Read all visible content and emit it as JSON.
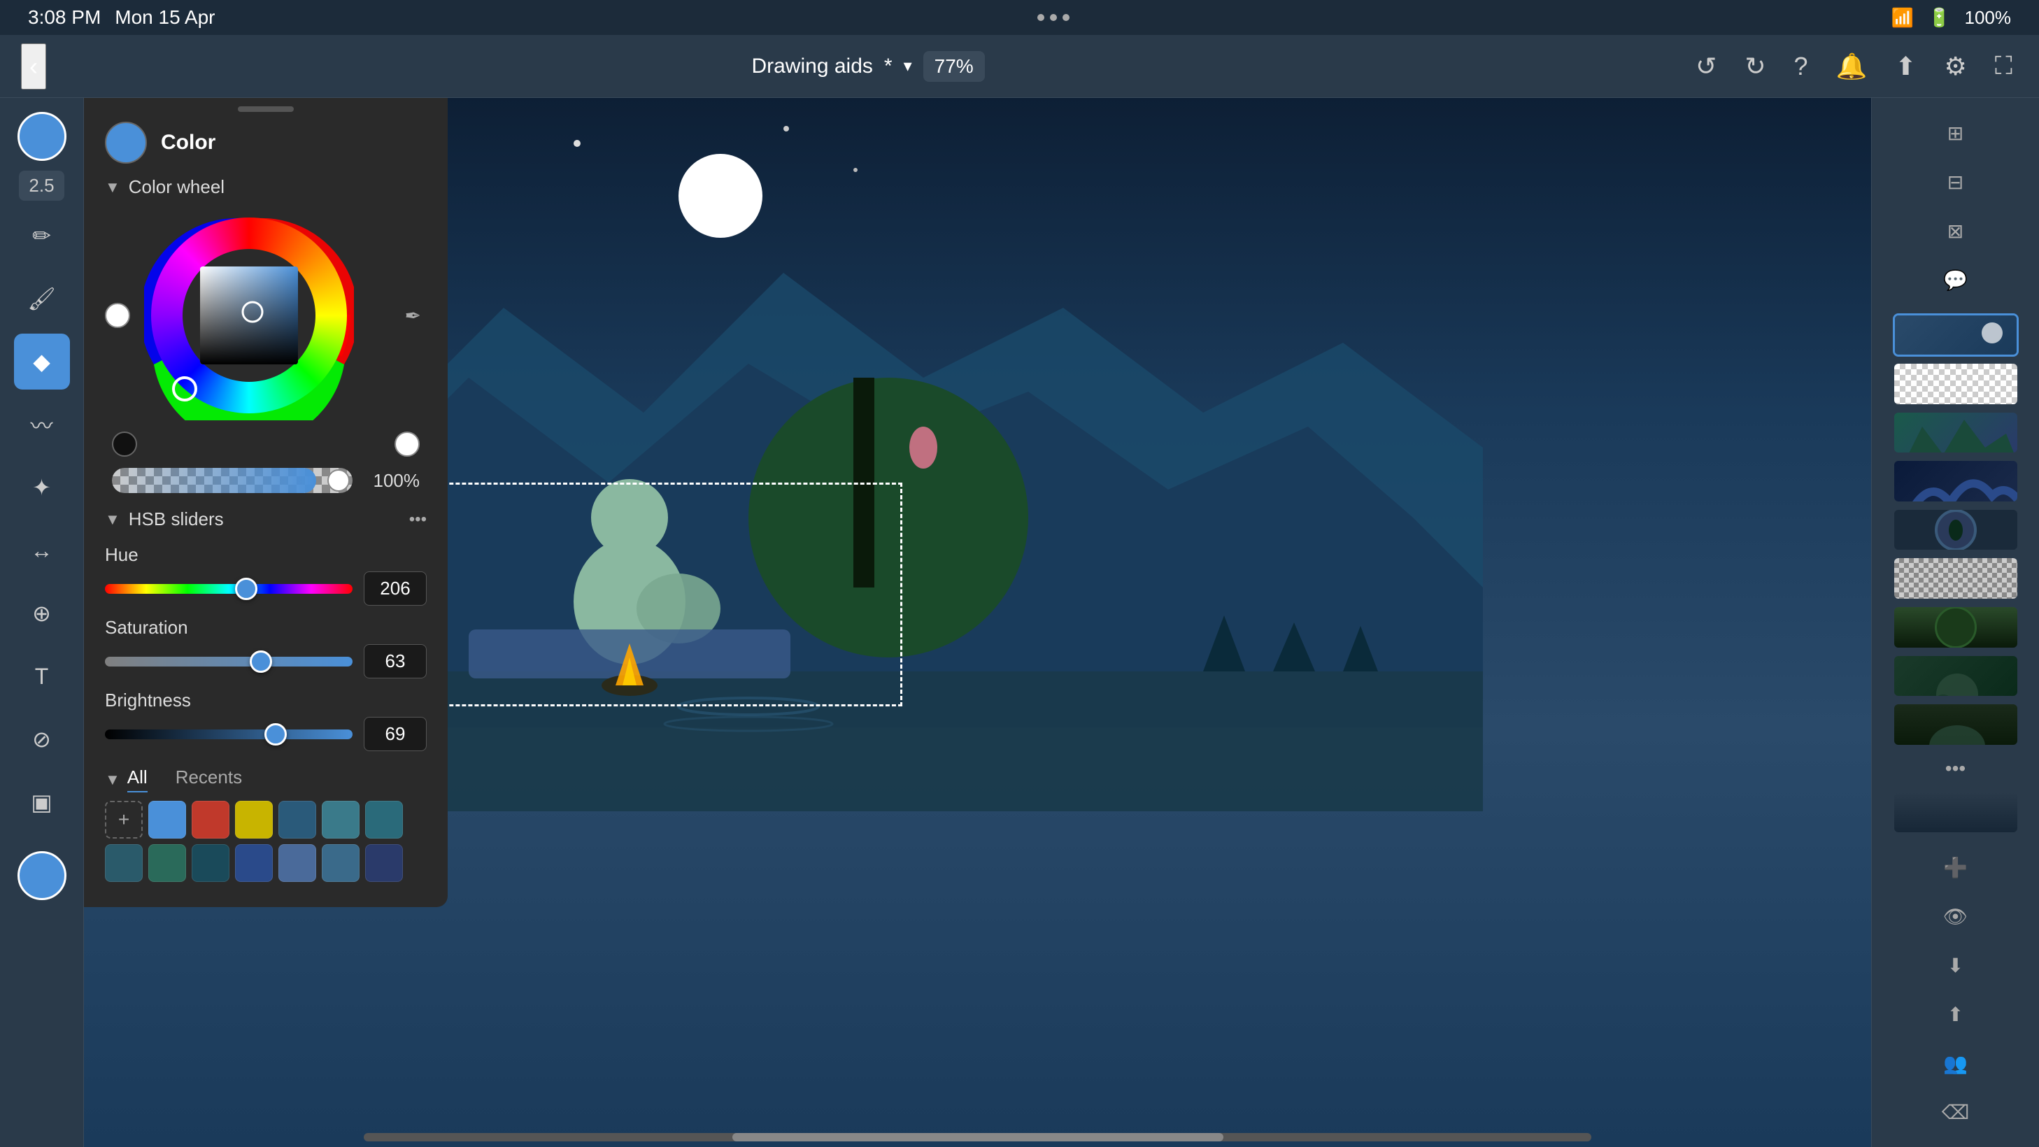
{
  "statusBar": {
    "time": "3:08 PM",
    "date": "Mon 15 Apr",
    "battery": "100%",
    "dotsLabel": "..."
  },
  "topToolbar": {
    "backLabel": "‹",
    "docTitle": "Drawing aids",
    "asterisk": "*",
    "dropdownLabel": "▾",
    "zoom": "77%",
    "undoLabel": "↺",
    "redoLabel": "↻",
    "helpLabel": "?",
    "notifLabel": "🔔",
    "shareLabel": "⬆",
    "settingsLabel": "⚙",
    "expandLabel": "⛶"
  },
  "leftToolbar": {
    "brushSize": "2.5",
    "tools": [
      {
        "name": "draw-tool",
        "icon": "✏️"
      },
      {
        "name": "paint-tool",
        "icon": "🖌"
      },
      {
        "name": "fill-tool",
        "icon": "◆"
      },
      {
        "name": "eraser-tool",
        "icon": "⬜"
      },
      {
        "name": "smudge-tool",
        "icon": "〰"
      },
      {
        "name": "effects-tool",
        "icon": "✦"
      },
      {
        "name": "selection-tool",
        "icon": "↔"
      },
      {
        "name": "transform-tool",
        "icon": "⊕"
      },
      {
        "name": "text-tool",
        "icon": "T"
      },
      {
        "name": "eyedropper-tool",
        "icon": "⊘"
      },
      {
        "name": "gallery-tool",
        "icon": "▣"
      }
    ]
  },
  "colorPanel": {
    "title": "Color",
    "colorWheelSection": "Color wheel",
    "transparencyValue": "100%",
    "hsbSection": "HSB sliders",
    "hue": {
      "label": "Hue",
      "value": "206",
      "thumbPercent": 57
    },
    "saturation": {
      "label": "Saturation",
      "value": "63",
      "thumbPercent": 63
    },
    "brightness": {
      "label": "Brightness",
      "value": "69",
      "thumbPercent": 69
    },
    "swatchTabs": [
      "All",
      "Recents"
    ],
    "activeSwatchTab": "All",
    "swatches": [
      "#4a90d9",
      "#c0392b",
      "#c8b400",
      "#2a5a7a",
      "#3a7a8a",
      "#2a6a7a",
      "#2a5a6a",
      "#2a6a5a",
      "#1a4a5a",
      "#2a4a8a",
      "#4a6a9a",
      "#3a6a8a"
    ]
  },
  "rightPanel": {
    "layers": [
      {
        "id": 1,
        "selected": true,
        "type": "mixed"
      },
      {
        "id": 2,
        "type": "empty"
      },
      {
        "id": 3,
        "type": "mountains"
      },
      {
        "id": 4,
        "type": "dark"
      },
      {
        "id": 5,
        "type": "circle"
      },
      {
        "id": 6,
        "type": "checkered"
      },
      {
        "id": 7,
        "type": "dark2"
      },
      {
        "id": 8,
        "type": "floral"
      },
      {
        "id": 9,
        "type": "character"
      },
      {
        "id": 10,
        "type": "fade"
      }
    ]
  },
  "canvas": {
    "zoom": "77%"
  }
}
